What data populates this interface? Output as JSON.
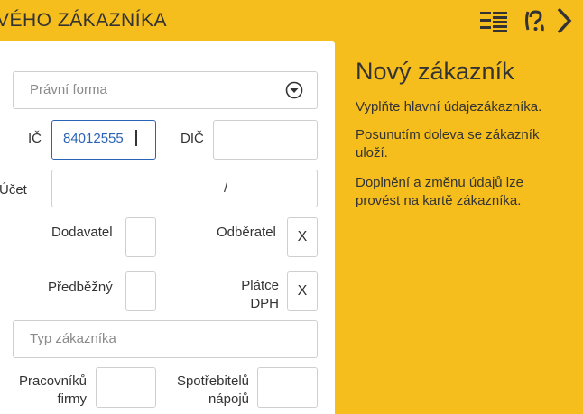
{
  "header": {
    "title": "VÉHO ZÁKAZNÍKA",
    "icons": [
      "list-icon",
      "help-icon",
      "chevron-right-icon"
    ]
  },
  "form": {
    "legal_form": {
      "placeholder": "Právní forma",
      "icon": "chevron-down-circle-icon"
    },
    "ic": {
      "label": "IČ",
      "value": "84012555"
    },
    "dic": {
      "label": "DIČ",
      "value": ""
    },
    "account": {
      "label": "Účet",
      "separator": "/"
    },
    "supplier": {
      "label": "Dodavatel",
      "value": ""
    },
    "customer": {
      "label": "Odběratel",
      "value": "X"
    },
    "preliminary": {
      "label": "Předběžný",
      "value": ""
    },
    "vat_payer": {
      "label_line1": "Plátce",
      "label_line2": "DPH",
      "value": "X"
    },
    "customer_type": {
      "placeholder": "Typ zákazníka"
    },
    "employees": {
      "label_line1": "Pracovníků",
      "label_line2": "firmy",
      "value": ""
    },
    "consumers": {
      "label_line1": "Spotřebitelů",
      "label_line2": "nápojů",
      "value": ""
    }
  },
  "info": {
    "title": "Nový zákazník",
    "p1": "Vyplňte hlavní údajezákazníka.",
    "p2": "Posunutím doleva se zákazník uloží.",
    "p3": "Doplnění a změnu údajů lze provést na kartě zákazníka."
  }
}
